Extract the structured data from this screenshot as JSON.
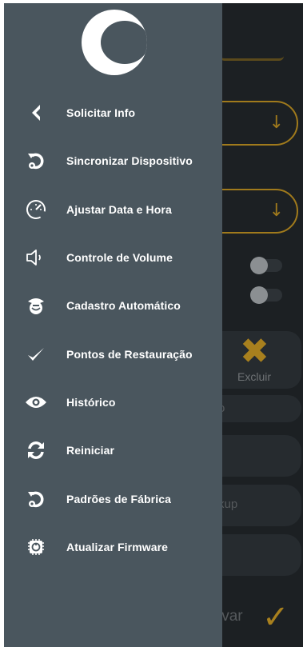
{
  "background": {
    "excluir_label": "Excluir",
    "partial_text_1": "o",
    "partial_text_2": "kup",
    "partial_text_3": "lvar"
  },
  "menu": {
    "items": [
      {
        "label": "Solicitar Info",
        "icon": "chevron-left-icon"
      },
      {
        "label": "Sincronizar Dispositivo",
        "icon": "sync-device-icon"
      },
      {
        "label": "Ajustar Data e Hora",
        "icon": "speedometer-icon"
      },
      {
        "label": "Controle de Volume",
        "icon": "volume-icon"
      },
      {
        "label": "Cadastro Automático",
        "icon": "auto-register-icon"
      },
      {
        "label": "Pontos de Restauração",
        "icon": "checkmark-icon"
      },
      {
        "label": "Histórico",
        "icon": "eye-icon"
      },
      {
        "label": "Reiniciar",
        "icon": "refresh-icon"
      },
      {
        "label": "Padrões de Fábrica",
        "icon": "factory-reset-icon"
      },
      {
        "label": "Atualizar Firmware",
        "icon": "chip-icon"
      }
    ]
  },
  "colors": {
    "drawer_bg": "#4a565e",
    "accent": "#a8801e"
  }
}
